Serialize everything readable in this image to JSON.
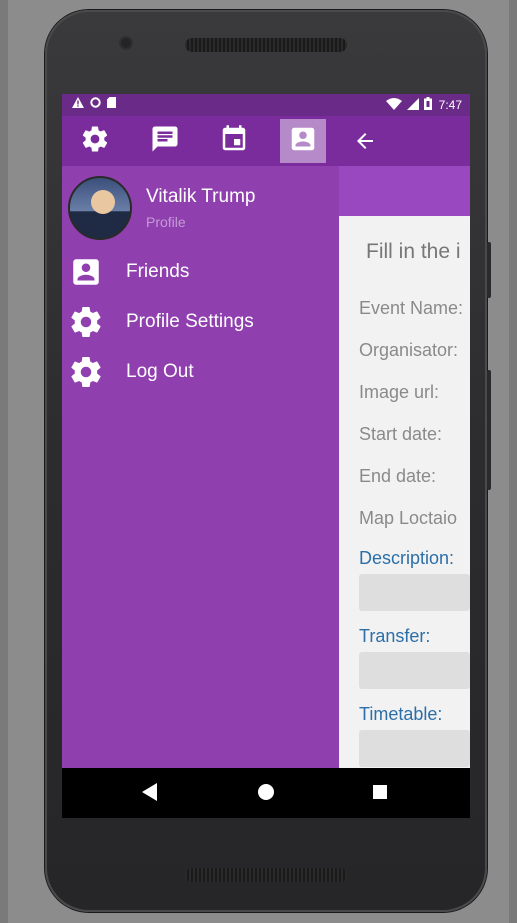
{
  "status_bar": {
    "left_icons": [
      "warning-icon",
      "circle-icon",
      "sd-card-icon"
    ],
    "right_icons": [
      "wifi-icon",
      "signal-icon",
      "battery-icon"
    ],
    "time": "7:47"
  },
  "tabs": [
    {
      "name": "settings-tab",
      "icon": "gear-icon",
      "active": false
    },
    {
      "name": "messages-tab",
      "icon": "message-icon",
      "active": false
    },
    {
      "name": "calendar-tab",
      "icon": "calendar-icon",
      "active": false
    },
    {
      "name": "profile-tab",
      "icon": "contact-icon",
      "active": true
    }
  ],
  "drawer": {
    "profile": {
      "name": "Vitalik Trump",
      "subtitle": "Profile"
    },
    "items": [
      {
        "label": "Friends",
        "icon": "contact-icon"
      },
      {
        "label": "Profile Settings",
        "icon": "gear-icon"
      },
      {
        "label": "Log Out",
        "icon": "gear-icon"
      }
    ]
  },
  "form": {
    "title": "Fill in the i",
    "fields": [
      "Event Name:",
      "Organisator:",
      "Image url:",
      "Start date:",
      "End date:",
      "Map Loctaio"
    ],
    "sections": [
      "Description:",
      "Transfer:",
      "Timetable:"
    ]
  },
  "colors": {
    "status_bar": "#6a2a87",
    "app_bar": "#7b2c9c",
    "drawer": "#8f3fae",
    "sub_bar": "#9a48bf",
    "active_tab": "#b689c8",
    "section_label": "#2c6fa8"
  }
}
